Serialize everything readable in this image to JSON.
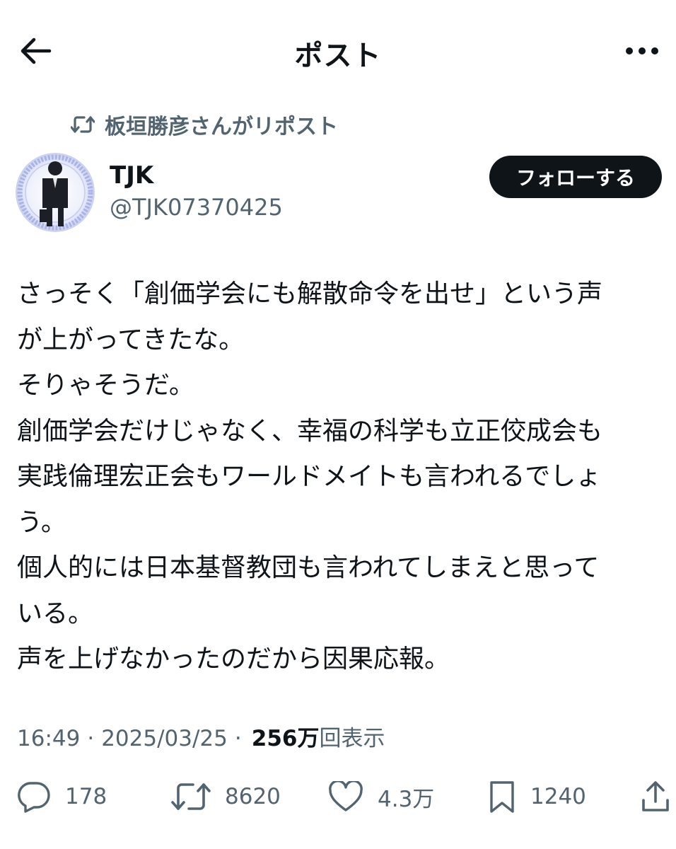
{
  "header": {
    "title": "ポスト",
    "back_icon": "arrow-left-icon",
    "more_icon": "more-horizontal-icon"
  },
  "repost_context": {
    "text": "板垣勝彦さんがリポスト",
    "icon": "repost-icon"
  },
  "author": {
    "display_name": "TJK",
    "handle": "@TJK07370425",
    "follow_label": "フォローする"
  },
  "post": {
    "lines": [
      "さっそく「創価学会にも解散命令を出せ」という声",
      "が上がってきたな。",
      "そりゃそうだ。",
      "創価学会だけじゃなく、幸福の科学も立正佼成会も",
      "実践倫理宏正会もワールドメイトも言われるでしょ",
      "う。",
      "個人的には日本基督教団も言われてしまえと思って",
      "いる。",
      "声を上げなかったのだから因果応報。"
    ]
  },
  "meta": {
    "time": "16:49",
    "separator": "·",
    "date": "2025/03/25",
    "views_count": "256万",
    "views_label": "回表示"
  },
  "actions": {
    "reply_count": "178",
    "repost_count": "8620",
    "like_count": "4.3万",
    "bookmark_count": "1240"
  },
  "colors": {
    "text_primary": "#0f1419",
    "text_secondary": "#536471",
    "button_bg": "#0f1419",
    "button_text": "#ffffff"
  }
}
